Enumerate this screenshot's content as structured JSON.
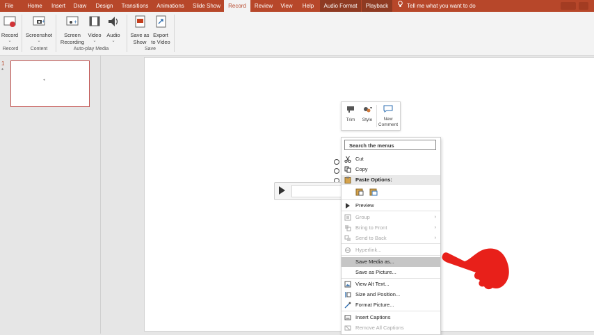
{
  "tabs": [
    {
      "label": "File"
    },
    {
      "label": "Home"
    },
    {
      "label": "Insert"
    },
    {
      "label": "Draw"
    },
    {
      "label": "Design"
    },
    {
      "label": "Transitions"
    },
    {
      "label": "Animations"
    },
    {
      "label": "Slide Show"
    },
    {
      "label": "Record"
    },
    {
      "label": "Review"
    },
    {
      "label": "View"
    },
    {
      "label": "Help"
    },
    {
      "label": "Audio Format"
    },
    {
      "label": "Playback"
    }
  ],
  "tell_me": "Tell me what you want to do",
  "ribbon": {
    "record": "Record",
    "screenshot": "Screenshot",
    "screen_recording_1": "Screen",
    "screen_recording_2": "Recording",
    "video": "Video",
    "audio": "Audio",
    "save_as_show_1": "Save as",
    "save_as_show_2": "Show",
    "export_video_1": "Export",
    "export_video_2": "to Video",
    "group_record": "Record",
    "group_content": "Content",
    "group_autoplay": "Auto-play Media",
    "group_save": "Save"
  },
  "thumbnails": {
    "slide_number": "1",
    "star": "*"
  },
  "mini_toolbar": {
    "trim": "Trim",
    "style": "Style",
    "new_comment_1": "New",
    "new_comment_2": "Comment"
  },
  "context_menu": {
    "search_placeholder": "Search the menus",
    "items": {
      "cut": "Cut",
      "copy": "Copy",
      "paste_options": "Paste Options:",
      "preview": "Preview",
      "group": "Group",
      "bring_to_front": "Bring to Front",
      "send_to_back": "Send to Back",
      "hyperlink": "Hyperlink...",
      "save_media_as": "Save Media as...",
      "save_as_picture": "Save as Picture...",
      "view_alt_text": "View Alt Text...",
      "size_and_position": "Size and Position...",
      "format_picture": "Format Picture...",
      "insert_captions": "Insert Captions",
      "remove_all_captions": "Remove All Captions"
    }
  },
  "colors": {
    "accent": "#b7472a",
    "hand": "#e8201a",
    "highlight": "#c6c6c6"
  }
}
